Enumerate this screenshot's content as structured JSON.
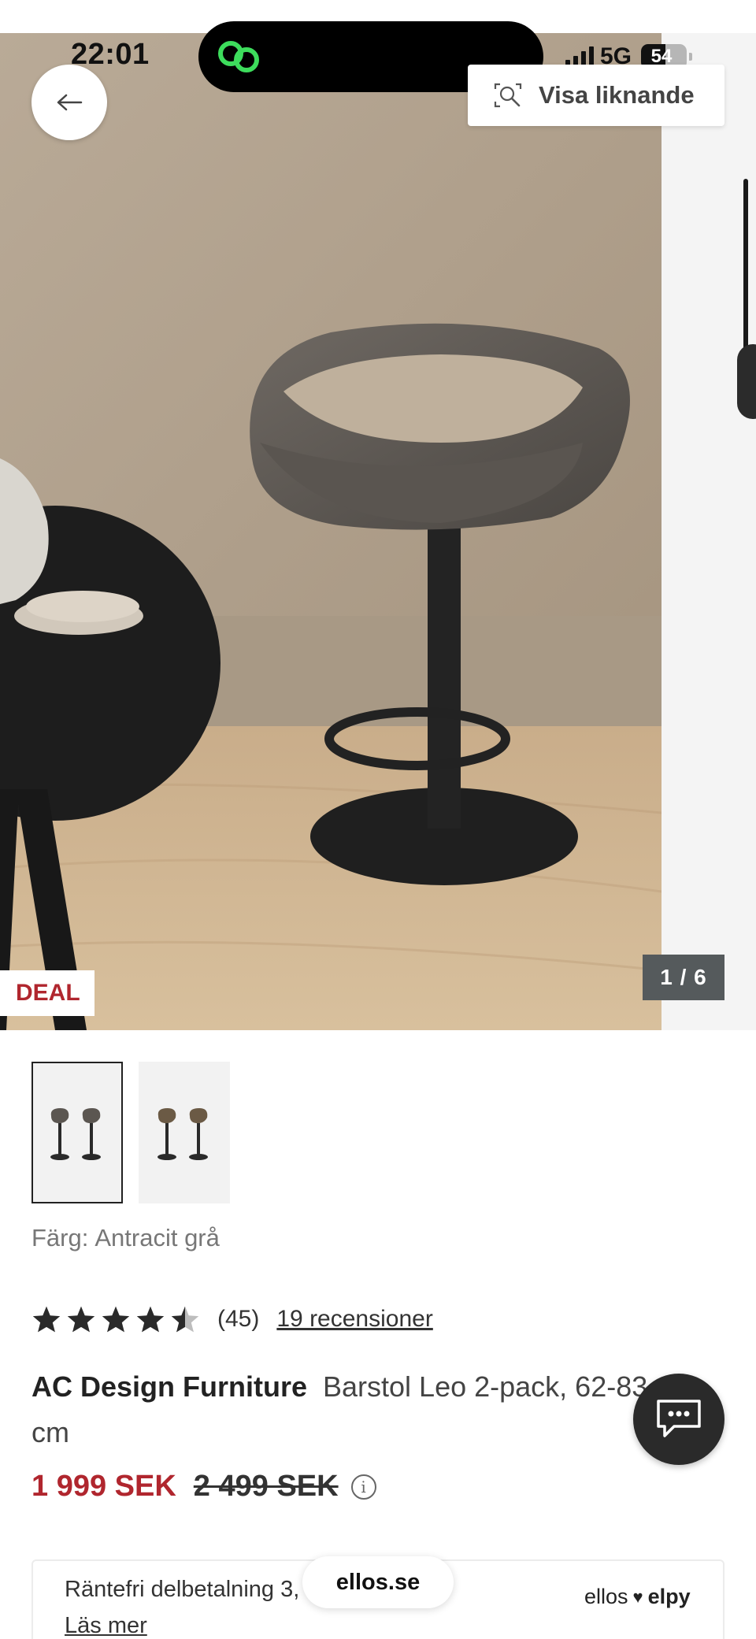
{
  "status_bar": {
    "time": "22:01",
    "network": "5G",
    "battery": "54"
  },
  "hero": {
    "similar_button_label": "Visa liknande",
    "deal_badge": "DEAL",
    "image_counter": "1 / 6"
  },
  "thumbnails": [
    {
      "selected": true
    },
    {
      "selected": false
    }
  ],
  "product": {
    "color_label": "Färg:",
    "color_value": "Antracit grå",
    "rating_value": 4.5,
    "rating_count": "(45)",
    "reviews_link": "19 recensioner",
    "brand": "AC Design Furniture",
    "name": "Barstol Leo 2-pack, 62-83 cm",
    "price_current": "1 999 SEK",
    "price_original": "2 499 SEK"
  },
  "financing": {
    "text": "Räntefri delbetalning 3, 6, 12 mån.",
    "link": "Läs mer",
    "partner_left": "ellos",
    "partner_right": "elpy"
  },
  "browser": {
    "url": "ellos.se"
  },
  "colors": {
    "sale_red": "#b0262e",
    "text_dark": "#222222",
    "muted": "#777777"
  }
}
